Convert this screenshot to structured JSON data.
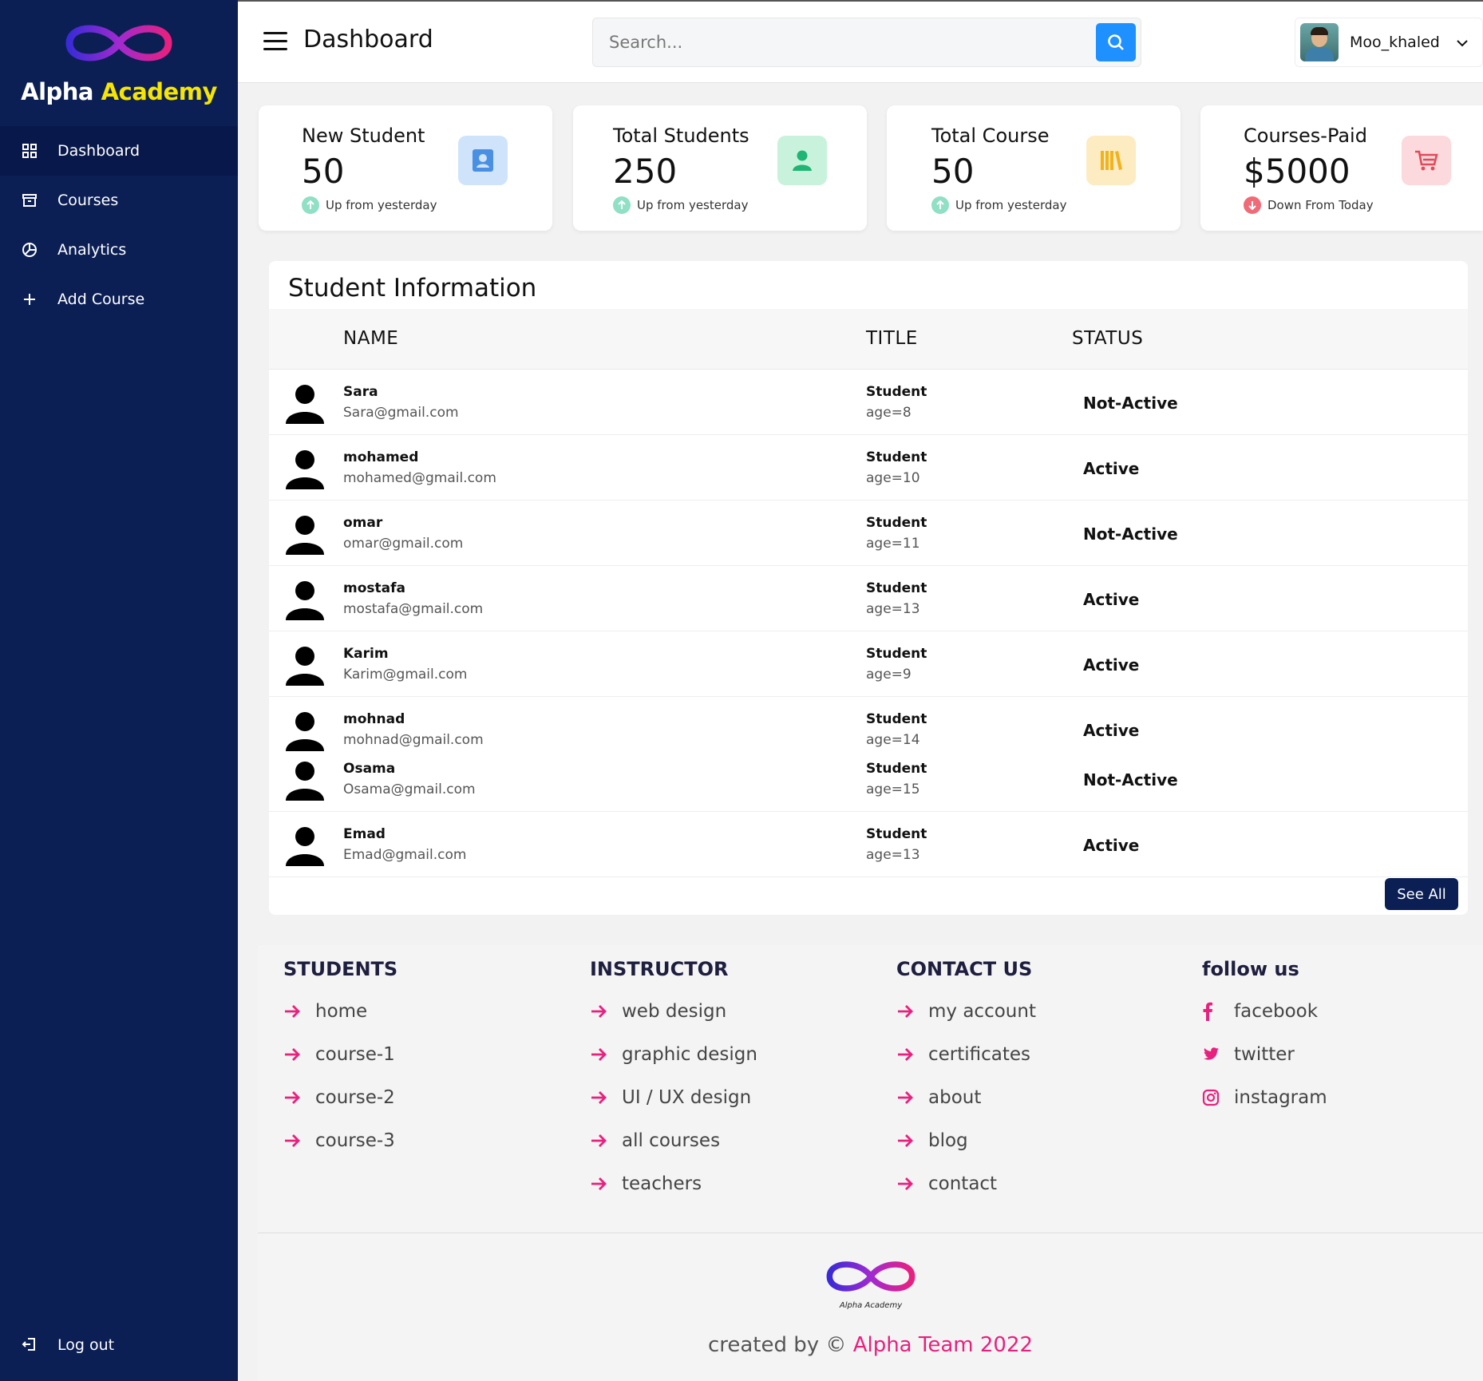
{
  "brand": {
    "part1": "Alpha",
    "part2": "Academy"
  },
  "sidebar": {
    "items": [
      {
        "label": "Dashboard",
        "icon": "grid-icon",
        "active": true
      },
      {
        "label": "Courses",
        "icon": "archive-icon",
        "active": false
      },
      {
        "label": "Analytics",
        "icon": "pie-chart-icon",
        "active": false
      },
      {
        "label": "Add Course",
        "icon": "plus-icon",
        "active": false
      }
    ],
    "logout": "Log out"
  },
  "header": {
    "title": "Dashboard",
    "search_placeholder": "Search...",
    "user_name": "Moo_khaled"
  },
  "cards": [
    {
      "title": "New Student",
      "value": "50",
      "trend": "Up from yesterday",
      "direction": "up",
      "icon": "contact-card-icon",
      "icon_color": "#4a90e2",
      "icon_bg": "#cfe4fb"
    },
    {
      "title": "Total Students",
      "value": "250",
      "trend": "Up from yesterday",
      "direction": "up",
      "icon": "user-icon",
      "icon_color": "#1fb574",
      "icon_bg": "#c9f2dc"
    },
    {
      "title": "Total Course",
      "value": "50",
      "trend": "Up from yesterday",
      "direction": "up",
      "icon": "books-icon",
      "icon_color": "#f2b21a",
      "icon_bg": "#fdebc2"
    },
    {
      "title": "Courses-Paid",
      "value": "$5000",
      "trend": "Down From Today",
      "direction": "down",
      "icon": "cart-icon",
      "icon_color": "#e24a5a",
      "icon_bg": "#fbd9dd"
    }
  ],
  "students": {
    "title": "Student Information",
    "columns": [
      "NAME",
      "TITLE",
      "STATUS"
    ],
    "rows": [
      {
        "name": "Sara",
        "email": "Sara@gmail.com",
        "title": "Student",
        "age": "age=8",
        "status": "Not-Active"
      },
      {
        "name": "mohamed",
        "email": "mohamed@gmail.com",
        "title": "Student",
        "age": "age=10",
        "status": "Active"
      },
      {
        "name": "omar",
        "email": "omar@gmail.com",
        "title": "Student",
        "age": "age=11",
        "status": "Not-Active"
      },
      {
        "name": "mostafa",
        "email": "mostafa@gmail.com",
        "title": "Student",
        "age": "age=13",
        "status": "Active"
      },
      {
        "name": "Karim",
        "email": "Karim@gmail.com",
        "title": "Student",
        "age": "age=9",
        "status": "Active"
      },
      {
        "name": "mohnad",
        "email": "mohnad@gmail.com",
        "title": "Student",
        "age": "age=14",
        "status": "Active"
      },
      {
        "name": "Osama",
        "email": "Osama@gmail.com",
        "title": "Student",
        "age": "age=15",
        "status": "Not-Active"
      },
      {
        "name": "Emad",
        "email": "Emad@gmail.com",
        "title": "Student",
        "age": "age=13",
        "status": "Active"
      }
    ],
    "see_all": "See All"
  },
  "footer": {
    "columns": [
      {
        "heading": "STUDENTS",
        "links": [
          "home",
          "course-1",
          "course-2",
          "course-3"
        ]
      },
      {
        "heading": "INSTRUCTOR",
        "links": [
          "web design",
          "graphic design",
          "UI / UX design",
          "all courses",
          "teachers"
        ]
      },
      {
        "heading": "CONTACT US",
        "links": [
          "my account",
          "certificates",
          "about",
          "blog",
          "contact"
        ]
      },
      {
        "heading": "follow us",
        "links": [
          "facebook",
          "twitter",
          "instagram"
        ],
        "icons": [
          "facebook-icon",
          "twitter-icon",
          "instagram-icon"
        ]
      }
    ],
    "logo_text": "Alpha Academy",
    "credit_prefix": "created by © ",
    "credit_highlight": "Alpha Team 2022"
  },
  "colors": {
    "sidebar": "#0b1f55",
    "accent_pink": "#e8207e",
    "search_button": "#1e90ff"
  }
}
